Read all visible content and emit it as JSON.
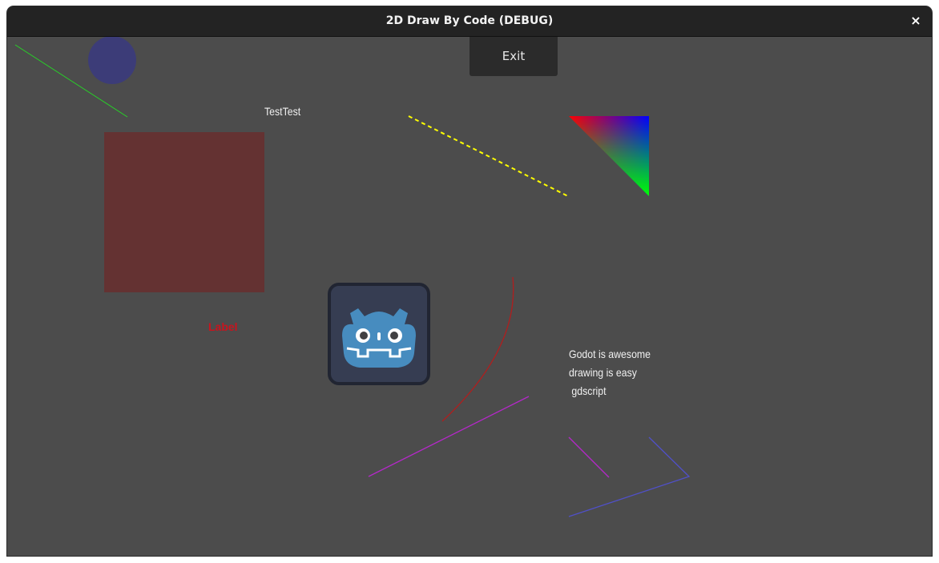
{
  "window": {
    "title": "2D Draw By Code (DEBUG)",
    "close_label": "×"
  },
  "toolbar": {
    "exit_label": "Exit"
  },
  "canvas": {
    "text_testtest": "TestTest",
    "label_text": "Label",
    "multiline": [
      "Godot is awesome",
      "drawing is easy",
      " gdscript"
    ],
    "colors": {
      "background": "#4c4c4c",
      "rect": "#643232",
      "circle": "#3c3c78",
      "green_line": "#27d327",
      "dashed_line": "#ffff00",
      "arc": "#c81e1e",
      "purple_line": "#b428c8",
      "blue_polyline": "#5050c8",
      "label": "#c8141e"
    },
    "icons": [
      "godot-logo-icon",
      "close-icon"
    ]
  }
}
